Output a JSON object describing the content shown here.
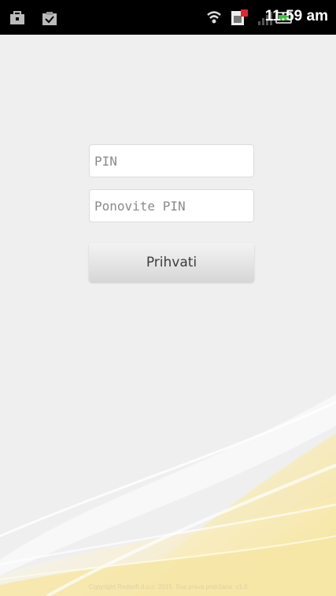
{
  "status_bar": {
    "time": "11:59 am",
    "icons_left": [
      "bag-icon",
      "clipboard-check-icon"
    ],
    "icons_right": [
      "wifi-icon",
      "sim-card-icon",
      "signal-icon",
      "battery-icon"
    ]
  },
  "form": {
    "pin_placeholder": "PIN",
    "repeat_pin_placeholder": "Ponovite PIN",
    "accept_label": "Prihvati"
  },
  "footer": {
    "copyright": "Copyright Redsoft d.o.o. 2015. Sva prava pridržana. v1.0"
  },
  "colors": {
    "background": "#efefef",
    "status_bar": "#000000",
    "wave_yellow": "#f4e29b",
    "wave_light": "#fbf3cf"
  }
}
